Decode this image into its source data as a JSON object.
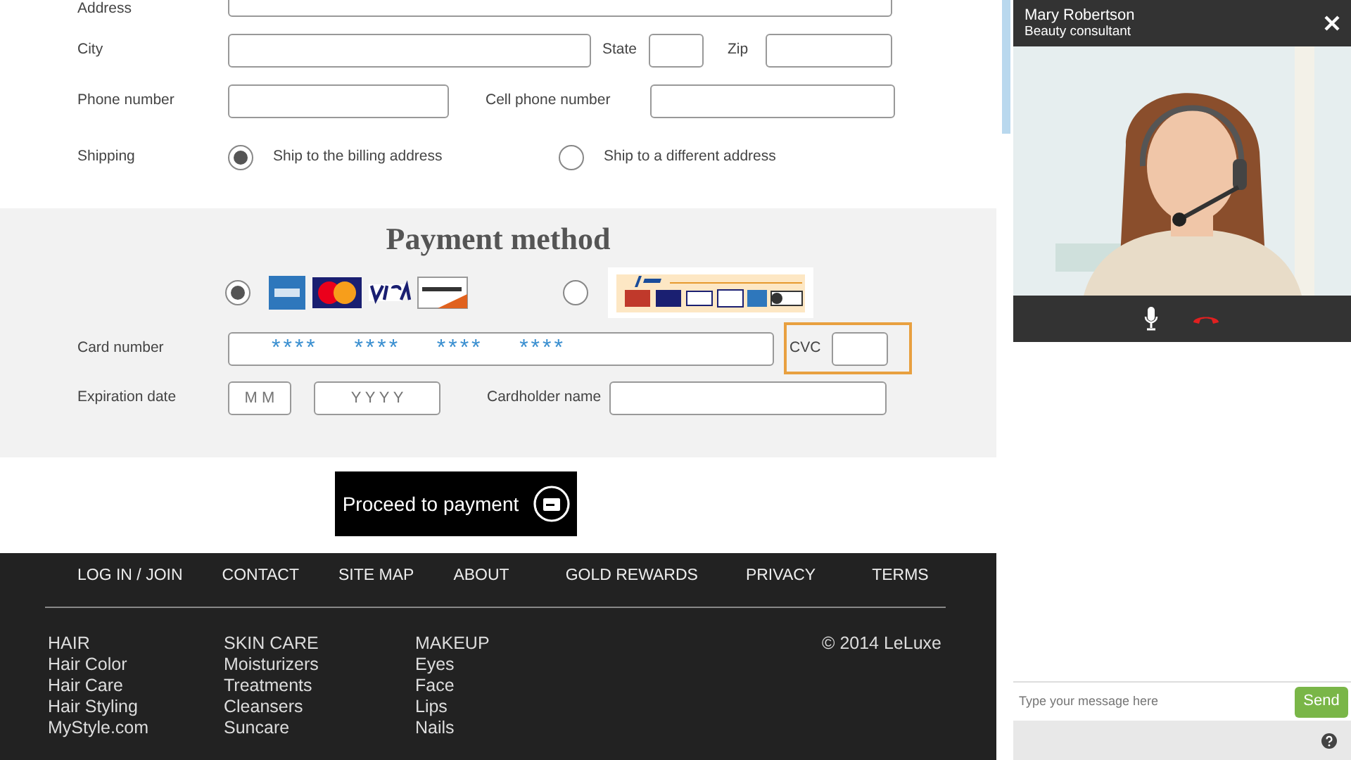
{
  "billing": {
    "address_label": "Address",
    "city_label": "City",
    "state_label": "State",
    "zip_label": "Zip",
    "phone_label": "Phone number",
    "cell_label": "Cell phone number",
    "shipping_label": "Shipping",
    "shipping_options": [
      {
        "label": "Ship to the billing address",
        "selected": true
      },
      {
        "label": "Ship to a different address",
        "selected": false
      }
    ]
  },
  "payment": {
    "title": "Payment method",
    "methods": [
      {
        "kind": "cards",
        "selected": true
      },
      {
        "kind": "paypal",
        "selected": false
      }
    ],
    "card_number_label": "Card number",
    "card_number_value": "****    ****    ****    ****",
    "cvc_label": "CVC",
    "cvc_highlighted": true,
    "expiration_label": "Expiration date",
    "month_placeholder": "M M",
    "year_placeholder": "Y Y Y Y",
    "cardholder_label": "Cardholder name"
  },
  "submit_button": "Proceed to payment",
  "footer": {
    "nav": [
      "LOG IN / JOIN",
      "CONTACT",
      "SITE MAP",
      "ABOUT",
      "GOLD REWARDS",
      "PRIVACY",
      "TERMS"
    ],
    "columns": [
      {
        "heading": "HAIR",
        "links": [
          "Hair Color",
          "Hair Care",
          "Hair Styling",
          "MyStyle.com"
        ]
      },
      {
        "heading": "SKIN CARE",
        "links": [
          "Moisturizers",
          "Treatments",
          "Cleansers",
          "Suncare"
        ]
      },
      {
        "heading": "MAKEUP",
        "links": [
          "Eyes",
          "Face",
          "Lips",
          "Nails"
        ]
      }
    ],
    "copyright": "© 2014 LeLuxe"
  },
  "chat": {
    "agent_name": "Mary Robertson",
    "agent_role": "Beauty consultant",
    "message_placeholder": "Type your message here",
    "send_button": "Send"
  }
}
